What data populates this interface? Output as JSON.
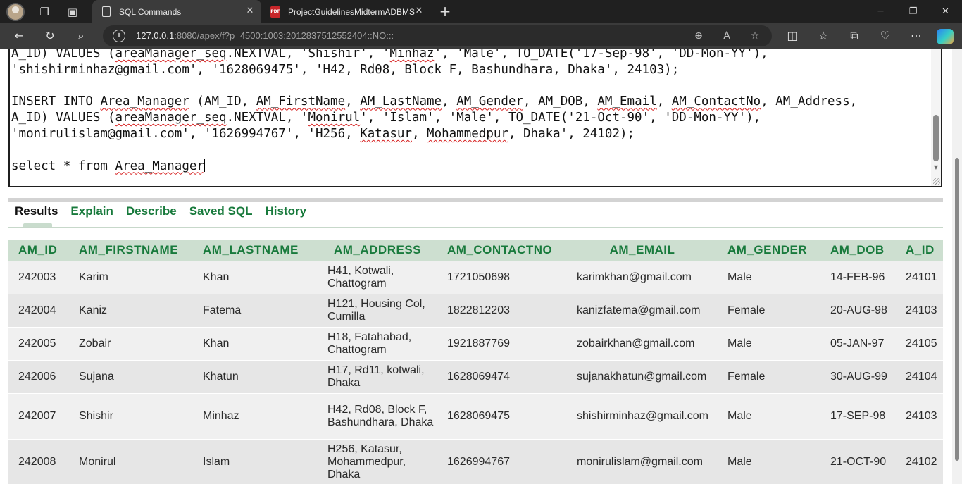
{
  "browser": {
    "tabs": [
      {
        "title": "SQL Commands",
        "active": true,
        "icon": "page-icon"
      },
      {
        "title": "ProjectGuidelinesMidtermADBMS",
        "active": false,
        "icon": "pdf-icon"
      }
    ],
    "url_host": "127.0.0.1",
    "url_rest": ":8080/apex/f?p=4500:1003:2012837512552404::NO:::"
  },
  "editor": {
    "lines": [
      "A_ID) VALUES (areaManager_seq.NEXTVAL, 'Shishir', 'Minhaz', 'Male', TO_DATE('17-Sep-98', 'DD-Mon-YY'),",
      "'shishirminhaz@gmail.com', '1628069475', 'H42, Rd08, Block F, Bashundhara, Dhaka', 24103);",
      "",
      "INSERT INTO Area_Manager (AM_ID, AM_FirstName, AM_LastName, AM_Gender, AM_DOB, AM_Email, AM_ContactNo, AM_Address,",
      "A_ID) VALUES (areaManager_seq.NEXTVAL, 'Monirul', 'Islam', 'Male', TO_DATE('21-Oct-90', 'DD-Mon-YY'),",
      "'monirulislam@gmail.com', '1626994767', 'H256, Katasur, Mohammedpur, Dhaka', 24102);",
      "",
      "select * from Area_Manager"
    ]
  },
  "result_tabs": [
    "Results",
    "Explain",
    "Describe",
    "Saved SQL",
    "History"
  ],
  "table": {
    "columns": [
      "AM_ID",
      "AM_FIRSTNAME",
      "AM_LASTNAME",
      "AM_ADDRESS",
      "AM_CONTACTNO",
      "AM_EMAIL",
      "AM_GENDER",
      "AM_DOB",
      "A_ID"
    ],
    "rows": [
      [
        "242003",
        "Karim",
        "Khan",
        "H41, Kotwali, Chattogram",
        "1721050698",
        "karimkhan@gmail.com",
        "Male",
        "14-FEB-96",
        "24101"
      ],
      [
        "242004",
        "Kaniz",
        "Fatema",
        "H121, Housing Col, Cumilla",
        "1822812203",
        "kanizfatema@gmail.com",
        "Female",
        "20-AUG-98",
        "24103"
      ],
      [
        "242005",
        "Zobair",
        "Khan",
        "H18, Fatahabad, Chattogram",
        "1921887769",
        "zobairkhan@gmail.com",
        "Male",
        "05-JAN-97",
        "24105"
      ],
      [
        "242006",
        "Sujana",
        "Khatun",
        "H17, Rd11, kotwali, Dhaka",
        "1628069474",
        "sujanakhatun@gmail.com",
        "Female",
        "30-AUG-99",
        "24104"
      ],
      [
        "242007",
        "Shishir",
        "Minhaz",
        "H42, Rd08, Block F, Bashundhara, Dhaka",
        "1628069475",
        "shishirminhaz@gmail.com",
        "Male",
        "17-SEP-98",
        "24103"
      ],
      [
        "242008",
        "Monirul",
        "Islam",
        "H256, Katasur, Mohammedpur, Dhaka",
        "1626994767",
        "monirulislam@gmail.com",
        "Male",
        "21-OCT-90",
        "24102"
      ]
    ]
  }
}
